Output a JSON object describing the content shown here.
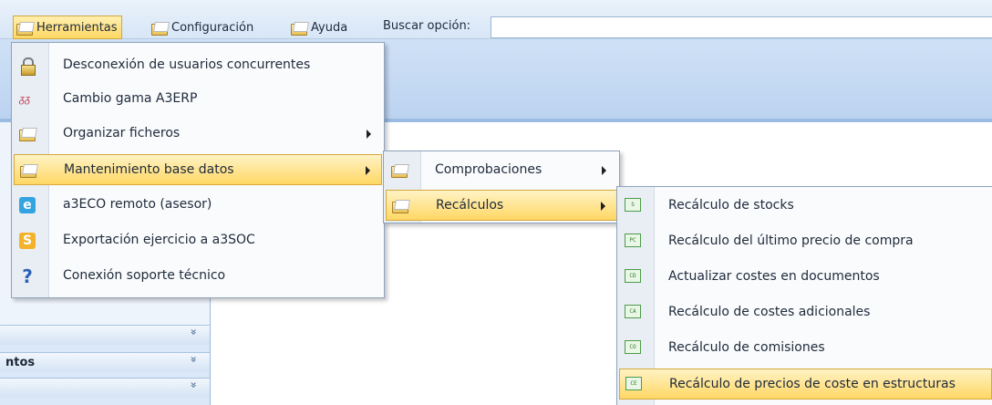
{
  "menubar": {
    "items": [
      {
        "label": "Herramientas",
        "icon": "folder-icon",
        "active": true
      },
      {
        "label": "Configuración",
        "icon": "folder-icon",
        "active": false
      },
      {
        "label": "Ayuda",
        "icon": "folder-icon",
        "active": false
      }
    ],
    "search_label": "Buscar opción:",
    "search_value": ""
  },
  "left_pane": {
    "rows": [
      {
        "title": "",
        "chevron": "»"
      },
      {
        "title": "ntos",
        "chevron": "»"
      },
      {
        "title": "",
        "chevron": "»"
      }
    ]
  },
  "menu_herramientas": {
    "items": [
      {
        "label": "Desconexión de usuarios concurrentes",
        "icon": "lock-icon",
        "submenu": false
      },
      {
        "label": "Cambio gama A3ERP",
        "icon": "gama-icon",
        "submenu": false
      },
      {
        "label": "Organizar ficheros",
        "icon": "folder-icon",
        "submenu": true
      },
      {
        "label": "Mantenimiento base datos",
        "icon": "folder-icon",
        "submenu": true,
        "highlighted": true
      },
      {
        "label": "a3ECO remoto (asesor)",
        "icon": "a3eco-icon",
        "submenu": false
      },
      {
        "label": "Exportación ejercicio a a3SOC",
        "icon": "a3soc-icon",
        "submenu": false
      },
      {
        "label": "Conexión soporte técnico",
        "icon": "help-icon",
        "submenu": false
      }
    ]
  },
  "menu_mantenimiento": {
    "items": [
      {
        "label": "Comprobaciones",
        "icon": "folder-icon",
        "submenu": true
      },
      {
        "label": "Recálculos",
        "icon": "folder-icon",
        "submenu": true,
        "highlighted": true
      }
    ]
  },
  "menu_recalculos": {
    "items": [
      {
        "label": "Recálculo de stocks",
        "icon": "stocks-doc-icon",
        "code": "S"
      },
      {
        "label": "Recálculo del último precio de compra",
        "icon": "price-doc-icon",
        "code": "PC"
      },
      {
        "label": "Actualizar costes en documentos",
        "icon": "costs-doc-icon",
        "code": "CD"
      },
      {
        "label": "Recálculo de costes adicionales",
        "icon": "extra-costs-doc-icon",
        "code": "CA"
      },
      {
        "label": "Recálculo de comisiones",
        "icon": "commissions-doc-icon",
        "code": "CO"
      },
      {
        "label": "Recálculo de precios de coste en estructuras",
        "icon": "structures-doc-icon",
        "code": "CE",
        "highlighted": true
      }
    ]
  }
}
